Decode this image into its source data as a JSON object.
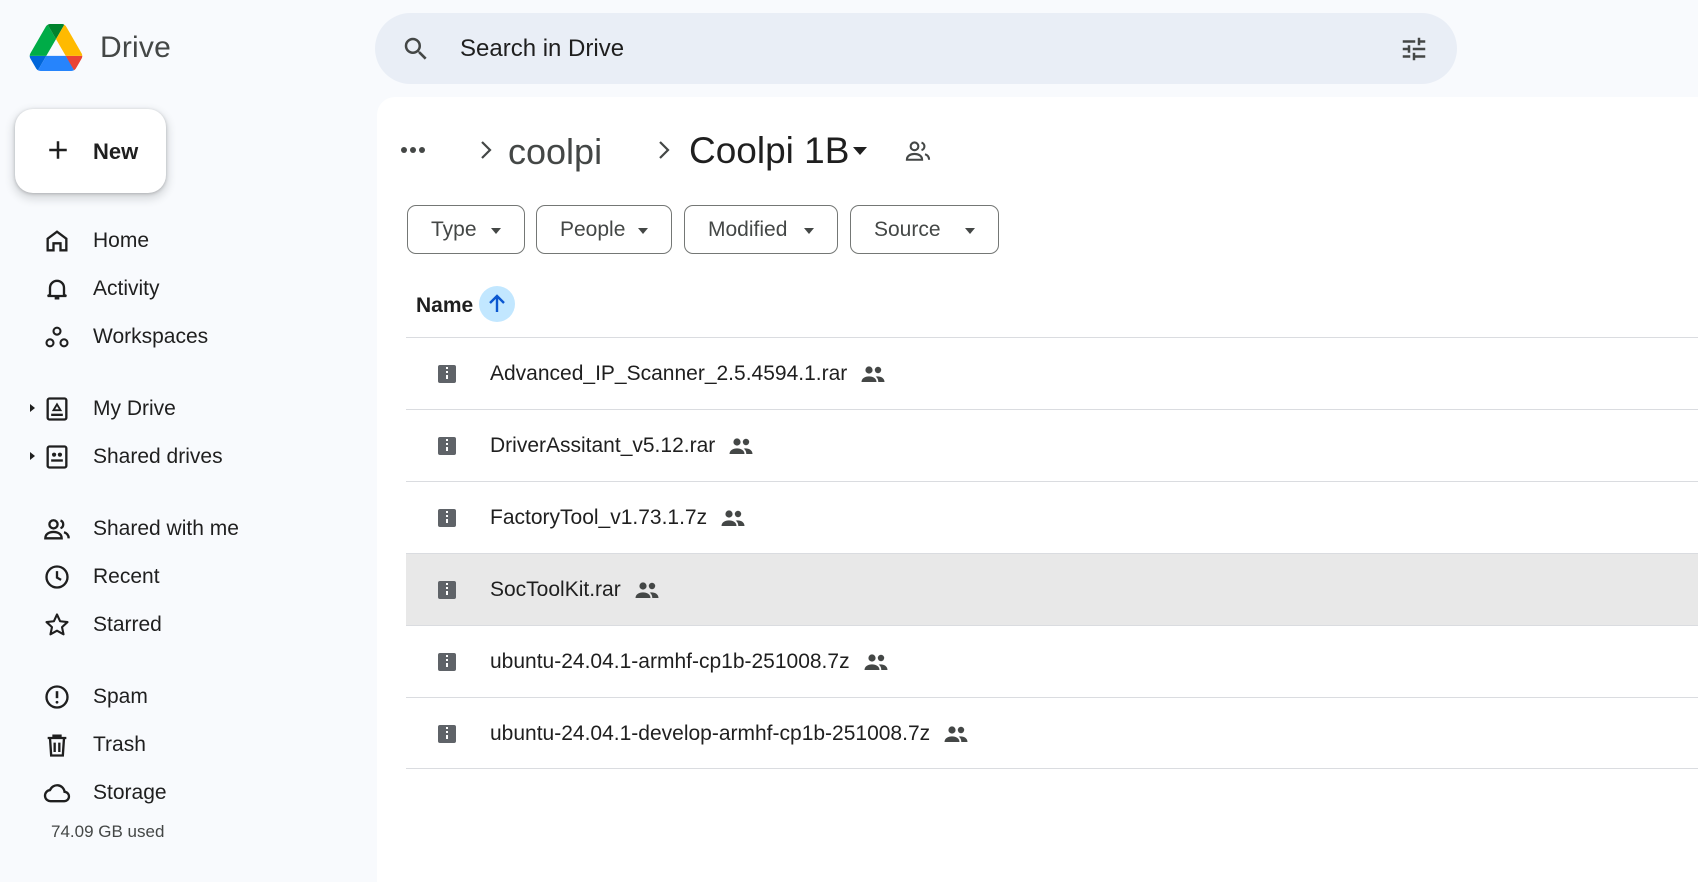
{
  "app": {
    "name": "Drive"
  },
  "search": {
    "placeholder": "Search in Drive"
  },
  "sidebar": {
    "new_label": "New",
    "items": [
      {
        "label": "Home",
        "icon": "home-icon"
      },
      {
        "label": "Activity",
        "icon": "bell-icon"
      },
      {
        "label": "Workspaces",
        "icon": "workspaces-icon"
      },
      {
        "label": "My Drive",
        "icon": "my-drive-icon"
      },
      {
        "label": "Shared drives",
        "icon": "shared-drives-icon"
      },
      {
        "label": "Shared with me",
        "icon": "people-icon"
      },
      {
        "label": "Recent",
        "icon": "clock-icon"
      },
      {
        "label": "Starred",
        "icon": "star-icon"
      },
      {
        "label": "Spam",
        "icon": "spam-icon"
      },
      {
        "label": "Trash",
        "icon": "trash-icon"
      },
      {
        "label": "Storage",
        "icon": "cloud-icon"
      }
    ],
    "storage_used": "74.09 GB used"
  },
  "breadcrumb": {
    "parent": "coolpi",
    "current": "Coolpi 1B"
  },
  "filters": [
    {
      "label": "Type"
    },
    {
      "label": "People"
    },
    {
      "label": "Modified"
    },
    {
      "label": "Source"
    }
  ],
  "list": {
    "column_name": "Name",
    "sort": "ascending",
    "files": [
      {
        "name": "Advanced_IP_Scanner_2.5.4594.1.rar",
        "shared": true,
        "selected": false
      },
      {
        "name": "DriverAssitant_v5.12.rar",
        "shared": true,
        "selected": false
      },
      {
        "name": "FactoryTool_v1.73.1.7z",
        "shared": true,
        "selected": false
      },
      {
        "name": "SocToolKit.rar",
        "shared": true,
        "selected": true
      },
      {
        "name": "ubuntu-24.04.1-armhf-cp1b-251008.7z",
        "shared": true,
        "selected": false
      },
      {
        "name": "ubuntu-24.04.1-develop-armhf-cp1b-251008.7z",
        "shared": true,
        "selected": false
      }
    ]
  },
  "colors": {
    "sort_badge": "#c2e7ff",
    "search_bg": "#e9eef6",
    "selected_row": "#e8e8e8"
  }
}
